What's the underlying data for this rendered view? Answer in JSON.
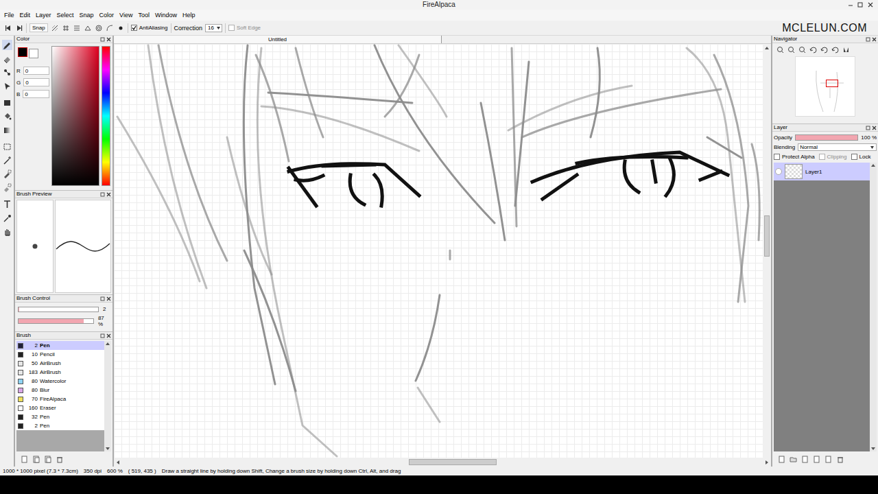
{
  "window": {
    "title": "FireAlpaca"
  },
  "menu": [
    "File",
    "Edit",
    "Layer",
    "Select",
    "Snap",
    "Color",
    "View",
    "Tool",
    "Window",
    "Help"
  ],
  "toolbar": {
    "snap": "Snap",
    "antialiasing": {
      "label": "AntiAliasing",
      "checked": true
    },
    "correction": {
      "label": "Correction",
      "value": "16"
    },
    "soft_edge": {
      "label": "Soft Edge",
      "checked": false,
      "disabled": true
    }
  },
  "watermark": "MCLELUN.COM",
  "color_panel": {
    "title": "Color",
    "channels": [
      {
        "label": "R",
        "value": "0"
      },
      {
        "label": "G",
        "value": "0"
      },
      {
        "label": "B",
        "value": "0"
      }
    ]
  },
  "brush_preview": {
    "title": "Brush Preview"
  },
  "brush_control": {
    "title": "Brush Control",
    "size": {
      "reading": "2",
      "level": 0.01
    },
    "opacity": {
      "reading": "87 %",
      "level": 0.87
    }
  },
  "brush_panel": {
    "title": "Brush",
    "items": [
      {
        "size": "2",
        "name": "Pen",
        "selected": true,
        "color": "#1f1f3a"
      },
      {
        "size": "10",
        "name": "Pencil",
        "selected": false,
        "color": "#222222"
      },
      {
        "size": "50",
        "name": "AirBrush",
        "selected": false,
        "color": "#e6e6e6"
      },
      {
        "size": "183",
        "name": "AirBrush",
        "selected": false,
        "color": "#e6e6e6"
      },
      {
        "size": "80",
        "name": "Watercolor",
        "selected": false,
        "color": "#8fd3f4"
      },
      {
        "size": "80",
        "name": "Blur",
        "selected": false,
        "color": "#d9a6e6"
      },
      {
        "size": "70",
        "name": "FireAlpaca",
        "selected": false,
        "color": "#f0e05a"
      },
      {
        "size": "160",
        "name": "Eraser",
        "selected": false,
        "color": "#ffffff"
      },
      {
        "size": "32",
        "name": "Pen",
        "selected": false,
        "color": "#222222"
      },
      {
        "size": "2",
        "name": "Pen",
        "selected": false,
        "color": "#222222"
      }
    ]
  },
  "canvas": {
    "tab": "Untitled"
  },
  "navigator": {
    "title": "Navigator"
  },
  "layer_panel": {
    "title": "Layer",
    "opacity": {
      "label": "Opacity",
      "reading": "100 %",
      "level": 1
    },
    "blending": {
      "label": "Blending",
      "value": "Normal"
    },
    "options": [
      {
        "label": "Protect Alpha",
        "checked": false,
        "disabled": false
      },
      {
        "label": "Clipping",
        "checked": false,
        "disabled": true
      },
      {
        "label": "Lock",
        "checked": false,
        "disabled": false
      }
    ],
    "layers": [
      {
        "name": "Layer1",
        "selected": true
      }
    ]
  },
  "status_bar": [
    "1000 * 1000 pixel  (7.3 * 7.3cm)",
    "350 dpi",
    "600 %",
    "( 519, 435 )",
    "Draw a straight line by holding down Shift, Change a brush size by holding down Ctrl, Alt, and drag"
  ]
}
